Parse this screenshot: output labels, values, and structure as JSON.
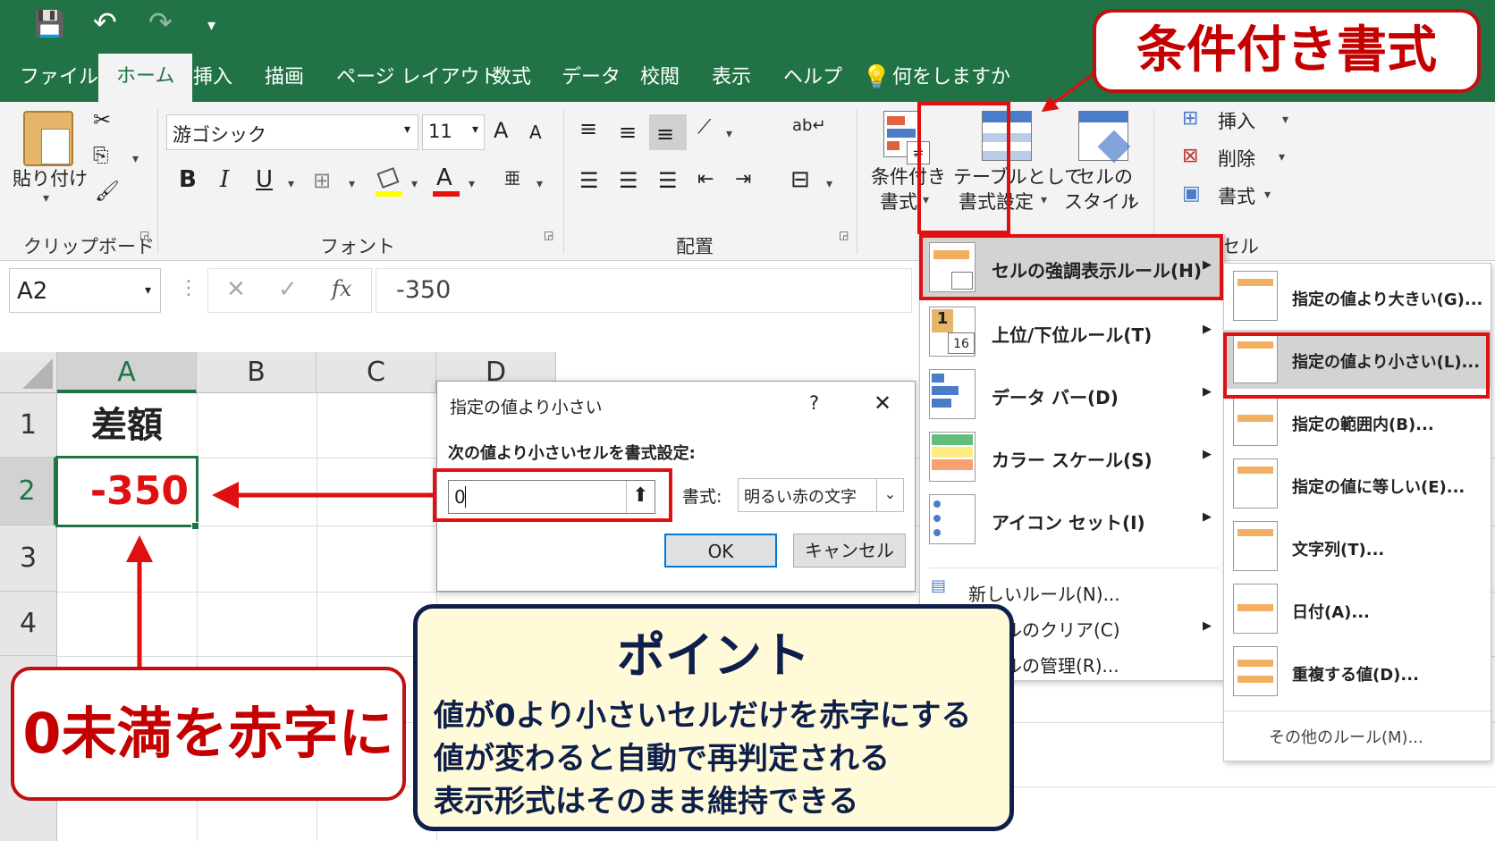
{
  "qat": {
    "save": "💾",
    "undo": "↶",
    "redo": "↷",
    "more": "▾"
  },
  "tabs": [
    "ファイル",
    "ホーム",
    "挿入",
    "描画",
    "ページ レイアウト",
    "数式",
    "データ",
    "校閲",
    "表示",
    "ヘルプ"
  ],
  "search": "何をしますか",
  "ribbon": {
    "clipboard": {
      "paste": "貼り付け",
      "label": "クリップボード"
    },
    "font": {
      "name": "游ゴシック",
      "size": "11",
      "bold": "B",
      "italic": "I",
      "underline": "U",
      "color_a": "A",
      "label": "フォント",
      "grow": "A",
      "shrink": "A"
    },
    "alignment": {
      "label": "配置"
    },
    "styles": {
      "cond_format_1": "条件付き",
      "cond_format_2": "書式",
      "table_1": "テーブルとして",
      "table_2": "書式設定",
      "cell_1": "セルの",
      "cell_2": "スタイル"
    },
    "cells": {
      "insert": "挿入",
      "delete": "削除",
      "format": "書式",
      "label": "セル"
    }
  },
  "formula_bar": {
    "name_box": "A2",
    "fx": "fx",
    "value": "-350"
  },
  "columns": [
    "A",
    "B",
    "C",
    "D"
  ],
  "rows": [
    "1",
    "2",
    "3",
    "4"
  ],
  "cells": {
    "A1": "差額",
    "A2": "-350"
  },
  "dialog": {
    "title": "指定の値より小さい",
    "help": "?",
    "close": "✕",
    "instruction": "次の値より小さいセルを書式設定:",
    "value": "0",
    "format_label": "書式:",
    "format_value": "明るい赤の文字",
    "ok": "OK",
    "cancel": "キャンセル"
  },
  "cf_menu": {
    "items": [
      "セルの強調表示ルール(H)",
      "上位/下位ルール(T)",
      "データ バー(D)",
      "カラー スケール(S)",
      "アイコン セット(I)"
    ],
    "extra": [
      "新しいルール(N)...",
      "ルールのクリア(C)",
      "ルールの管理(R)..."
    ],
    "top_icon_number": "1",
    "bottom_icon_number": "16"
  },
  "submenu": {
    "items": [
      "指定の値より大きい(G)...",
      "指定の値より小さい(L)...",
      "指定の範囲内(B)...",
      "指定の値に等しい(E)...",
      "文字列(T)...",
      "日付(A)...",
      "重複する値(D)..."
    ],
    "more": "その他のルール(M)..."
  },
  "annotations": {
    "title": "条件付き書式",
    "red_note": "0未満を赤字に",
    "point_title": "ポイント",
    "point_lines": [
      "値が0より小さいセルだけを赤字にする",
      "値が変わると自動で再判定される",
      "表示形式はそのまま維持できる"
    ]
  },
  "colors": {
    "excel_green": "#217346",
    "annotation_red": "#e01010",
    "point_bg": "#fffbd8",
    "point_border": "#0d1f4a"
  }
}
